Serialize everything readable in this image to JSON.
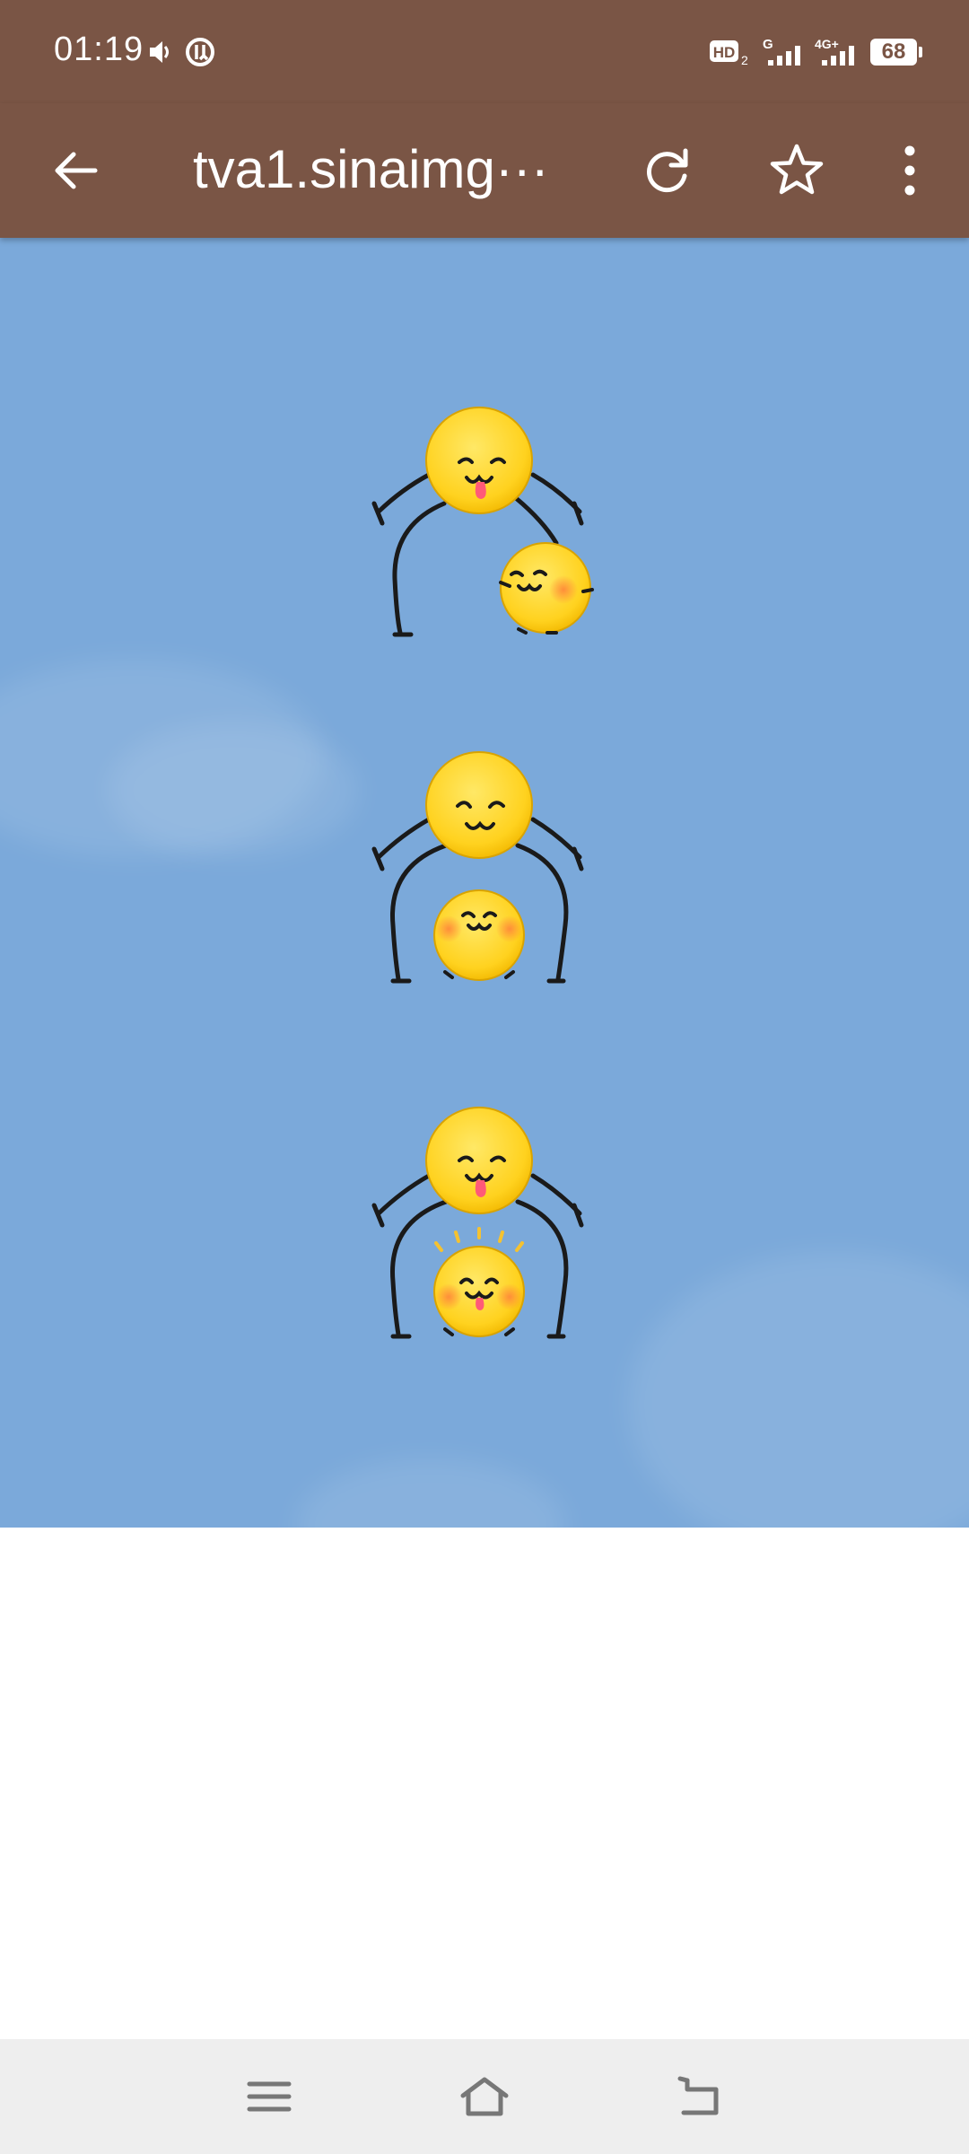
{
  "status_bar": {
    "time": "01:19",
    "battery": "68",
    "icons": [
      "volume-icon",
      "data-saver-icon",
      "hd-icon",
      "signal-g-icon",
      "signal-4g-plus-icon",
      "battery-icon"
    ]
  },
  "toolbar": {
    "url": "tva1.sinaimg···",
    "icons": [
      "back-arrow-icon",
      "reload-icon",
      "star-icon",
      "more-vert-icon"
    ]
  },
  "content": {
    "background": "#7ba9da",
    "figures": [
      {
        "pose": "small-sticker-stepping-out",
        "sparkles": false
      },
      {
        "pose": "small-sticker-underneath",
        "sparkles": false
      },
      {
        "pose": "small-sticker-happy",
        "sparkles": true
      }
    ]
  },
  "bottom_nav": {
    "icons": [
      "menu-icon",
      "home-icon",
      "back-icon"
    ]
  },
  "colors": {
    "toolbar": "#7a5545",
    "sky": "#7ba9da",
    "sticker_yellow": "#ffd21f",
    "nav_background": "#eeeeee"
  }
}
